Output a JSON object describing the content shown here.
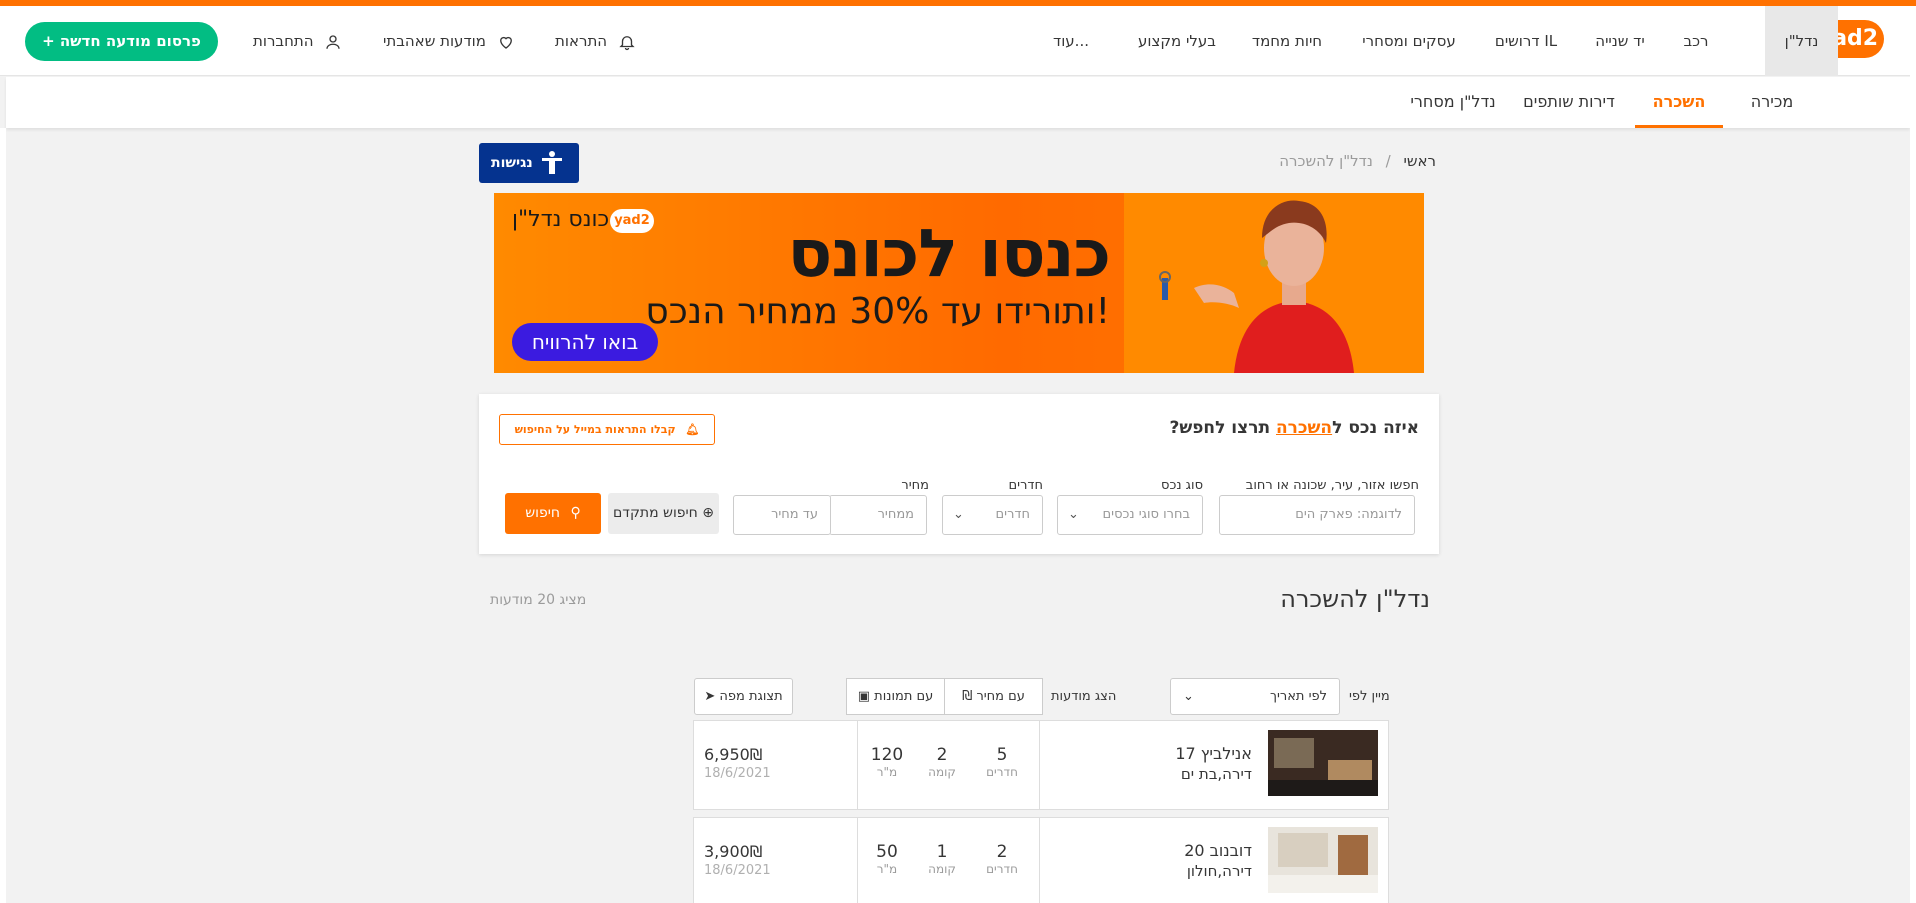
{
  "brand": {
    "logo_text": "yad2",
    "accent": "#ff7100",
    "green": "#02bd83"
  },
  "header": {
    "nav": [
      "נדל\"ן",
      "רכב",
      "יד שנייה",
      "דרושים IL",
      "עסקים ומסחרי",
      "חיות מחמד",
      "בעלי מקצוע",
      "עוד..."
    ],
    "alerts": "התראות",
    "favorites": "מודעות שאהבתי",
    "login": "התחברות",
    "post_ad": "+ פרסום מודעה חדשה"
  },
  "subnav": [
    "מכירה",
    "השכרה",
    "דירות שותפים",
    "נדל\"ן מסחרי"
  ],
  "breadcrumb": {
    "home": "ראשי",
    "sep": "/",
    "current": "נדל\"ן להשכרה"
  },
  "accessibility": "נגישות",
  "banner": {
    "title": "כנסו לכונס",
    "subtitle": "ותורידו עד 30% ממחיר הנכס!",
    "brand": "כונס נדל\"ן",
    "brand_logo": "yad2",
    "cta": "בואו להרוויח"
  },
  "search": {
    "title_pre": "איזה נכס ל",
    "title_hl": "השכרה",
    "title_post": " תרצו לחפש?",
    "alert_btn": "קבלו התראות במייל על החיפוש",
    "fields": {
      "area_label": "חפשו אזור, עיר, שכונה או רחוב",
      "area_placeholder": "לדוגמה: פארק הים",
      "type_label": "סוג נכס",
      "type_placeholder": "בחרו סוגי נכסים",
      "rooms_label": "חדרים",
      "rooms_placeholder": "חדרים",
      "price_label": "מחיר",
      "price_min": "ממחיר",
      "price_max": "עד מחיר"
    },
    "advanced": "חיפוש מתקדם",
    "submit": "חיפוש"
  },
  "results": {
    "title": "נדל\"ן להשכרה",
    "count": "מציג 20 מודעות",
    "sort_label": "מיין לפי",
    "sort_value": "לפי תאריך",
    "show_label": "הצג מודעות",
    "with_price": "עם מחיר",
    "with_photos": "עם תמונות",
    "map_view": "תצוגת מפה",
    "listings": [
      {
        "address": "אנילביץ 17",
        "type_city": "דירה,בת ים",
        "rooms": "5",
        "rooms_l": "חדרים",
        "floor": "2",
        "floor_l": "קומה",
        "size": "120",
        "size_l": "מ\"ר",
        "price": "6,950₪",
        "date": "18/6/2021"
      },
      {
        "address": "דובנוב 20",
        "type_city": "דירה,חולון",
        "rooms": "2",
        "rooms_l": "חדרים",
        "floor": "1",
        "floor_l": "קומה",
        "size": "50",
        "size_l": "מ\"ר",
        "price": "3,900₪",
        "date": "18/6/2021"
      }
    ]
  }
}
